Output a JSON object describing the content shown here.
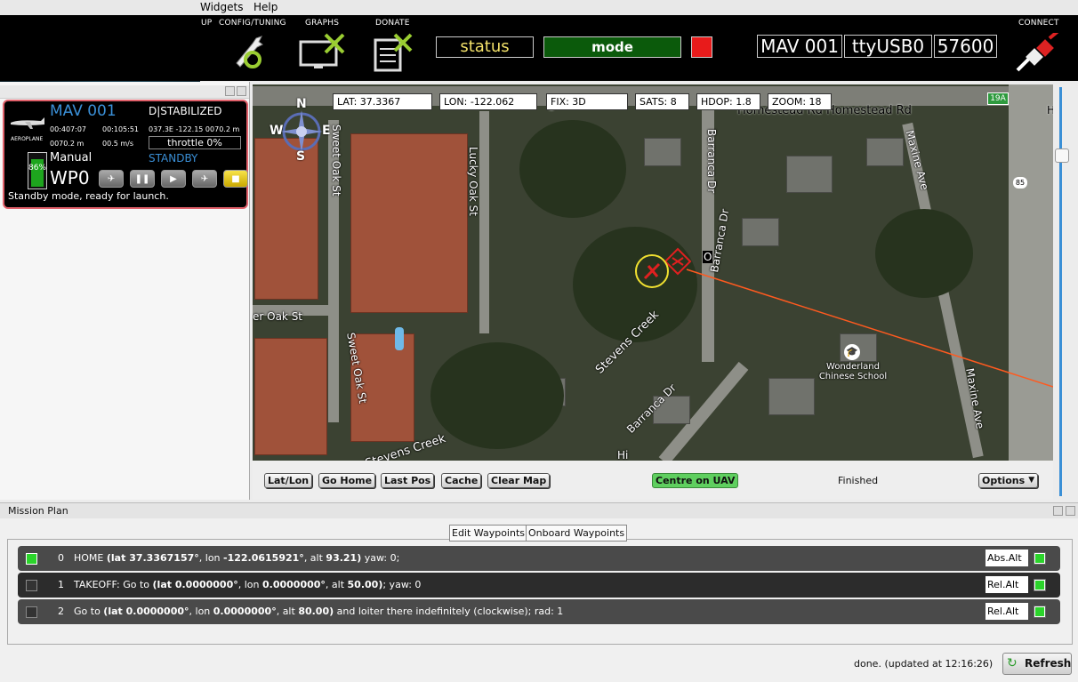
{
  "menubar": {
    "items": [
      "Widgets",
      "Help"
    ]
  },
  "toolbar": {
    "setup_fragment": "UP",
    "config_label": "CONFIG/TUNING",
    "graphs_label": "GRAPHS",
    "donate_label": "DONATE",
    "connect_label": "CONNECT",
    "status": "status",
    "mode": "mode",
    "mav_name": "MAV 001",
    "port": "ttyUSB0",
    "baud": "57600"
  },
  "uav": {
    "name": "MAV 001",
    "type": "AEROPLANE",
    "mode_state": "D|STABILIZED",
    "time1": "00:407:07",
    "time2": "00:105:51",
    "position": "037.3E -122.15 0070.2 m",
    "altitude": "0070.2 m",
    "speed": "00.5 m/s",
    "throttle": "throttle 0%",
    "flight_mode": "Manual",
    "state": "STANDBY",
    "waypoint": "WP0",
    "battery": "86%",
    "battery_level": 0.86,
    "message": "Standby mode, ready for launch."
  },
  "map": {
    "lat": "LAT: 37.3367",
    "lon": "LON: -122.062",
    "fix": "FIX: 3D",
    "sats": "SATS: 8",
    "hdop": "HDOP: 1.8",
    "zoom": "ZOOM: 18",
    "labels": {
      "homestead": "Homestead Rd   Homestead Rd",
      "lucky_oak": "Lucky Oak St",
      "sweet_oak_1": "Sweet Oak St",
      "sweet_oak_2": "Sweet Oak St",
      "barranca_1": "Barranca Dr",
      "barranca_2": "Barranca Dr",
      "barranca_3": "Barranca Dr",
      "maxine_1": "Maxine Ave",
      "maxine_2": "Maxine Ave",
      "stevens_1": "Stevens Creek",
      "stevens_2": "Stevens Creek",
      "oak_st": "er Oak St",
      "school": "Wonderland\nChinese School",
      "hwy_19a": "19A",
      "hwy_85": "85",
      "hi": "Hi",
      "ro": "O",
      "e_frag": "e",
      "a_frag": "A",
      "h_frag": "H"
    },
    "compass": {
      "n": "N",
      "s": "S",
      "e": "E",
      "w": "W"
    }
  },
  "map_buttons": {
    "latlon": "Lat/Lon",
    "go_home": "Go Home",
    "last_pos": "Last Pos",
    "cache": "Cache",
    "clear_map": "Clear Map",
    "centre": "Centre on UAV",
    "status": "Finished",
    "options": "Options"
  },
  "mission": {
    "title": "Mission Plan",
    "tab_edit": "Edit Waypoints",
    "tab_onboard": "Onboard Waypoints",
    "rows": [
      {
        "num": "0",
        "prefix": "HOME ",
        "open": "(lat ",
        "lat": "37.3367157°",
        "mid": ", lon ",
        "lon": "-122.0615921°",
        "alt_prefix": ", alt ",
        "alt": "93.21)",
        "suffix": " yaw: 0;",
        "alt_mode": "Abs.Alt",
        "checked": true
      },
      {
        "num": "1",
        "prefix": "TAKEOFF: Go to ",
        "open": "(lat ",
        "lat": "0.0000000°",
        "mid": ", lon ",
        "lon": "0.0000000°",
        "alt_prefix": ", alt ",
        "alt": "50.00)",
        "suffix": "; yaw: 0",
        "alt_mode": "Rel.Alt",
        "checked": false
      },
      {
        "num": "2",
        "prefix": "Go to ",
        "open": "(lat ",
        "lat": "0.0000000°",
        "mid": ", lon ",
        "lon": "0.0000000°",
        "alt_prefix": ", alt ",
        "alt": "80.00)",
        "suffix": " and loiter there indefinitely (clockwise); rad: 1",
        "alt_mode": "Rel.Alt",
        "checked": false
      }
    ],
    "footer_status": "done. (updated at 12:16:26)",
    "refresh": "Refresh"
  },
  "colors": {
    "status_text": "#f4e26a",
    "mode_bg": "#0b5a0b",
    "alert": "#e81b1b",
    "card_border": "#e0606a",
    "uav_name": "#3a8fd6",
    "centre_btn": "#5fcf5f",
    "waypoint_ok": "#2bd42b"
  }
}
